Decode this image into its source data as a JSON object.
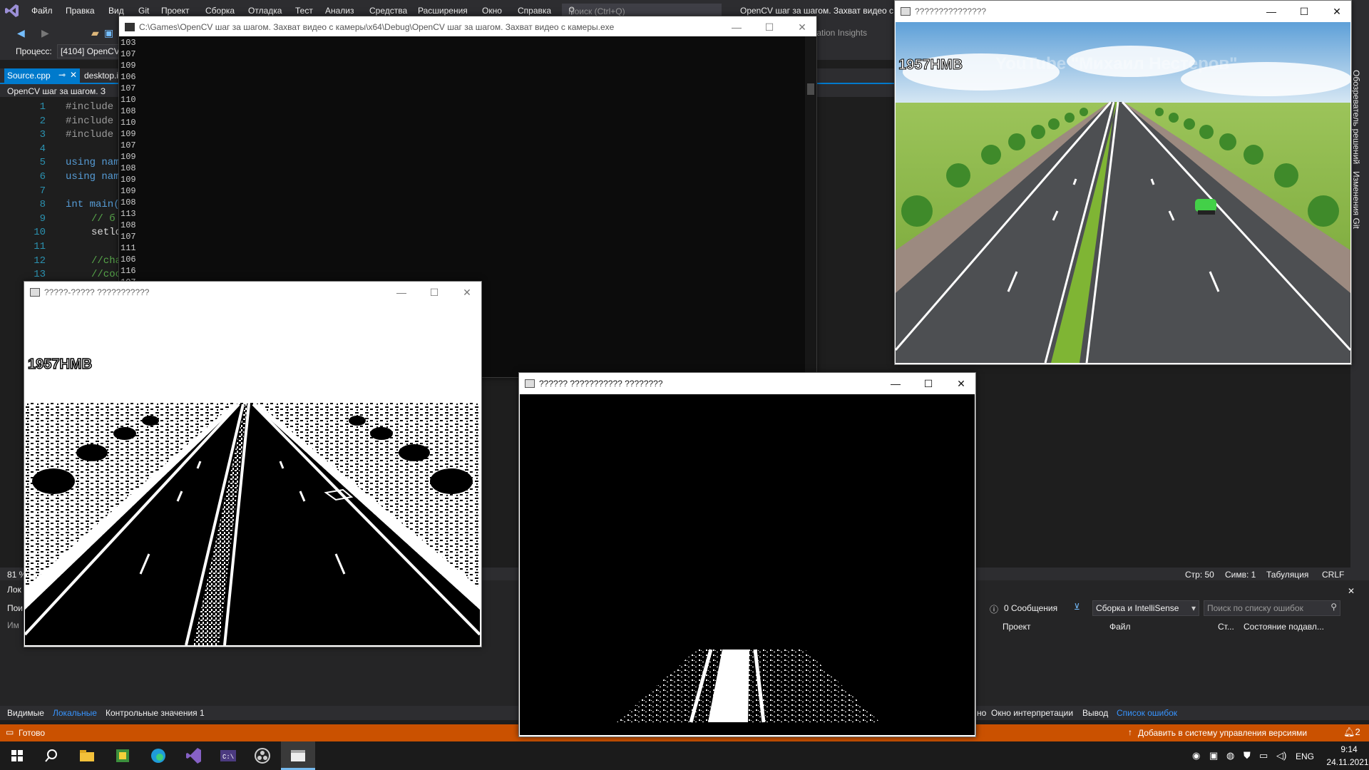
{
  "vs": {
    "menu": [
      "Файл",
      "Правка",
      "Вид",
      "Git",
      "Проект",
      "Сборка",
      "Отладка",
      "Тест",
      "Анализ",
      "Средства",
      "Расширения",
      "Окно",
      "Справка"
    ],
    "search_placeholder": "Поиск (Ctrl+Q)",
    "window_title": "OpenCV шаг за шагом. Захват видео с",
    "process_label": "Процесс:",
    "process_value": "[4104] OpenCV",
    "insights": "lication Insights",
    "tabs": {
      "source": "Source.cpp",
      "pin": "ᵖ",
      "desktop": "desktop.i"
    },
    "nav_project": "OpenCV шаг за шагом. З",
    "code_lines": [
      {
        "n": "1",
        "t": "#include"
      },
      {
        "n": "2",
        "t": "#include"
      },
      {
        "n": "3",
        "t": "#include"
      },
      {
        "n": "4",
        "t": ""
      },
      {
        "n": "5",
        "t": "using nam"
      },
      {
        "n": "6",
        "t": "using nam"
      },
      {
        "n": "7",
        "t": ""
      },
      {
        "n": "8",
        "t": "int main("
      },
      {
        "n": "9",
        "t": "// б"
      },
      {
        "n": "10",
        "t": "setlo"
      },
      {
        "n": "11",
        "t": ""
      },
      {
        "n": "12",
        "t": "//cha"
      },
      {
        "n": "13",
        "t": "//coo"
      }
    ],
    "zoom": "81 %",
    "status_line": "Стр: 50",
    "status_col": "Симв: 1",
    "status_tab": "Табуляция",
    "status_eol": "CRLF",
    "left_panel_title": "Лок",
    "left_panel_search": "Пои",
    "left_panel_col": "Им",
    "messages": "0 Сообщения",
    "build_filter": "Сборка и IntelliSense",
    "error_search": "Поиск по списку ошибок",
    "err_cols": [
      "Проект",
      "Файл",
      "Ст...",
      "Состояние подавл..."
    ],
    "bottom_tabs_left": [
      "Видимые",
      "Локальные",
      "Контрольные значения 1"
    ],
    "bottom_tabs_right": [
      "но",
      "Окно интерпретации",
      "Вывод",
      "Список ошибок"
    ],
    "status_ready": "Готово",
    "status_vc": "Добавить в систему управления версиями",
    "notif_count": "2",
    "side_panel": [
      "Обозреватель решений",
      "Изменения Git"
    ]
  },
  "console": {
    "title": "C:\\Games\\OpenCV шаг за шагом. Захват видео с камеры\\x64\\Debug\\OpenCV шаг за шагом. Захват видео с камеры.exe",
    "lines": [
      "103",
      "107",
      "109",
      "106",
      "107",
      "110",
      "108",
      "110",
      "109",
      "107",
      "109",
      "108",
      "109",
      "109",
      "108",
      "113",
      "108",
      "107",
      "111",
      "106",
      "116",
      "107"
    ]
  },
  "win_color": {
    "title": "???????????????",
    "plate": "1957HMB",
    "watermark": "YouTube \"Михаил Нестеров\""
  },
  "win_bw": {
    "title": "?????-????? ???????????",
    "plate": "1957HMB"
  },
  "win_mask": {
    "title": "?????? ??????????? ????????"
  },
  "win_controls": {
    "min": "—",
    "max": "☐",
    "close": "✕"
  },
  "taskbar": {
    "icons": [
      "windows-start",
      "search",
      "file-explorer",
      "app-1",
      "edge",
      "visual-studio",
      "terminal",
      "obs",
      "app-window"
    ],
    "lang": "ENG",
    "time": "9:14",
    "date": "24.11.2021"
  },
  "colors": {
    "accent": "#007acc",
    "status": "#ca5100",
    "vs_bg": "#1e1e1e",
    "road": "#4a4a4a",
    "grass": "#78a83a"
  }
}
